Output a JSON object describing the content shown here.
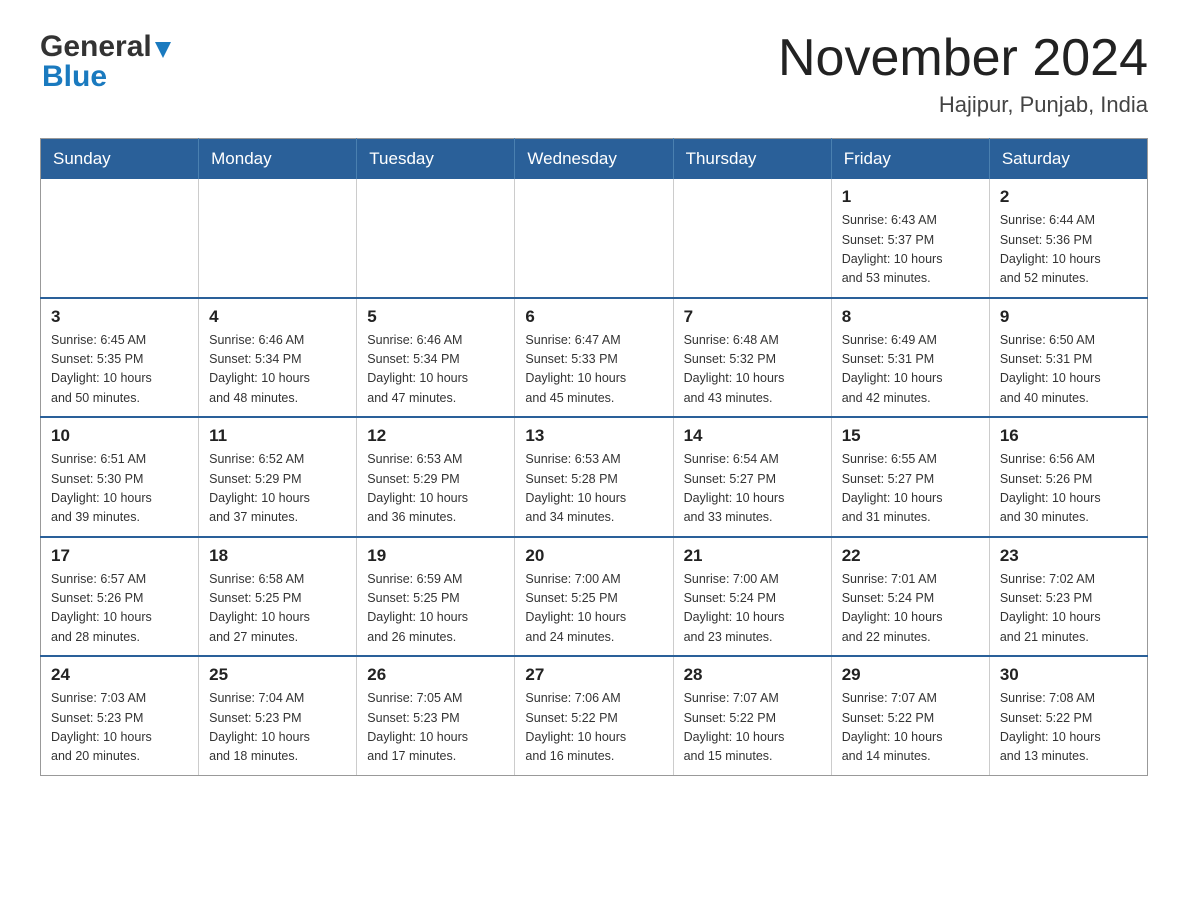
{
  "header": {
    "logo_general": "General",
    "logo_blue": "Blue",
    "title": "November 2024",
    "subtitle": "Hajipur, Punjab, India"
  },
  "weekdays": [
    "Sunday",
    "Monday",
    "Tuesday",
    "Wednesday",
    "Thursday",
    "Friday",
    "Saturday"
  ],
  "weeks": [
    [
      {
        "day": "",
        "info": ""
      },
      {
        "day": "",
        "info": ""
      },
      {
        "day": "",
        "info": ""
      },
      {
        "day": "",
        "info": ""
      },
      {
        "day": "",
        "info": ""
      },
      {
        "day": "1",
        "info": "Sunrise: 6:43 AM\nSunset: 5:37 PM\nDaylight: 10 hours\nand 53 minutes."
      },
      {
        "day": "2",
        "info": "Sunrise: 6:44 AM\nSunset: 5:36 PM\nDaylight: 10 hours\nand 52 minutes."
      }
    ],
    [
      {
        "day": "3",
        "info": "Sunrise: 6:45 AM\nSunset: 5:35 PM\nDaylight: 10 hours\nand 50 minutes."
      },
      {
        "day": "4",
        "info": "Sunrise: 6:46 AM\nSunset: 5:34 PM\nDaylight: 10 hours\nand 48 minutes."
      },
      {
        "day": "5",
        "info": "Sunrise: 6:46 AM\nSunset: 5:34 PM\nDaylight: 10 hours\nand 47 minutes."
      },
      {
        "day": "6",
        "info": "Sunrise: 6:47 AM\nSunset: 5:33 PM\nDaylight: 10 hours\nand 45 minutes."
      },
      {
        "day": "7",
        "info": "Sunrise: 6:48 AM\nSunset: 5:32 PM\nDaylight: 10 hours\nand 43 minutes."
      },
      {
        "day": "8",
        "info": "Sunrise: 6:49 AM\nSunset: 5:31 PM\nDaylight: 10 hours\nand 42 minutes."
      },
      {
        "day": "9",
        "info": "Sunrise: 6:50 AM\nSunset: 5:31 PM\nDaylight: 10 hours\nand 40 minutes."
      }
    ],
    [
      {
        "day": "10",
        "info": "Sunrise: 6:51 AM\nSunset: 5:30 PM\nDaylight: 10 hours\nand 39 minutes."
      },
      {
        "day": "11",
        "info": "Sunrise: 6:52 AM\nSunset: 5:29 PM\nDaylight: 10 hours\nand 37 minutes."
      },
      {
        "day": "12",
        "info": "Sunrise: 6:53 AM\nSunset: 5:29 PM\nDaylight: 10 hours\nand 36 minutes."
      },
      {
        "day": "13",
        "info": "Sunrise: 6:53 AM\nSunset: 5:28 PM\nDaylight: 10 hours\nand 34 minutes."
      },
      {
        "day": "14",
        "info": "Sunrise: 6:54 AM\nSunset: 5:27 PM\nDaylight: 10 hours\nand 33 minutes."
      },
      {
        "day": "15",
        "info": "Sunrise: 6:55 AM\nSunset: 5:27 PM\nDaylight: 10 hours\nand 31 minutes."
      },
      {
        "day": "16",
        "info": "Sunrise: 6:56 AM\nSunset: 5:26 PM\nDaylight: 10 hours\nand 30 minutes."
      }
    ],
    [
      {
        "day": "17",
        "info": "Sunrise: 6:57 AM\nSunset: 5:26 PM\nDaylight: 10 hours\nand 28 minutes."
      },
      {
        "day": "18",
        "info": "Sunrise: 6:58 AM\nSunset: 5:25 PM\nDaylight: 10 hours\nand 27 minutes."
      },
      {
        "day": "19",
        "info": "Sunrise: 6:59 AM\nSunset: 5:25 PM\nDaylight: 10 hours\nand 26 minutes."
      },
      {
        "day": "20",
        "info": "Sunrise: 7:00 AM\nSunset: 5:25 PM\nDaylight: 10 hours\nand 24 minutes."
      },
      {
        "day": "21",
        "info": "Sunrise: 7:00 AM\nSunset: 5:24 PM\nDaylight: 10 hours\nand 23 minutes."
      },
      {
        "day": "22",
        "info": "Sunrise: 7:01 AM\nSunset: 5:24 PM\nDaylight: 10 hours\nand 22 minutes."
      },
      {
        "day": "23",
        "info": "Sunrise: 7:02 AM\nSunset: 5:23 PM\nDaylight: 10 hours\nand 21 minutes."
      }
    ],
    [
      {
        "day": "24",
        "info": "Sunrise: 7:03 AM\nSunset: 5:23 PM\nDaylight: 10 hours\nand 20 minutes."
      },
      {
        "day": "25",
        "info": "Sunrise: 7:04 AM\nSunset: 5:23 PM\nDaylight: 10 hours\nand 18 minutes."
      },
      {
        "day": "26",
        "info": "Sunrise: 7:05 AM\nSunset: 5:23 PM\nDaylight: 10 hours\nand 17 minutes."
      },
      {
        "day": "27",
        "info": "Sunrise: 7:06 AM\nSunset: 5:22 PM\nDaylight: 10 hours\nand 16 minutes."
      },
      {
        "day": "28",
        "info": "Sunrise: 7:07 AM\nSunset: 5:22 PM\nDaylight: 10 hours\nand 15 minutes."
      },
      {
        "day": "29",
        "info": "Sunrise: 7:07 AM\nSunset: 5:22 PM\nDaylight: 10 hours\nand 14 minutes."
      },
      {
        "day": "30",
        "info": "Sunrise: 7:08 AM\nSunset: 5:22 PM\nDaylight: 10 hours\nand 13 minutes."
      }
    ]
  ]
}
